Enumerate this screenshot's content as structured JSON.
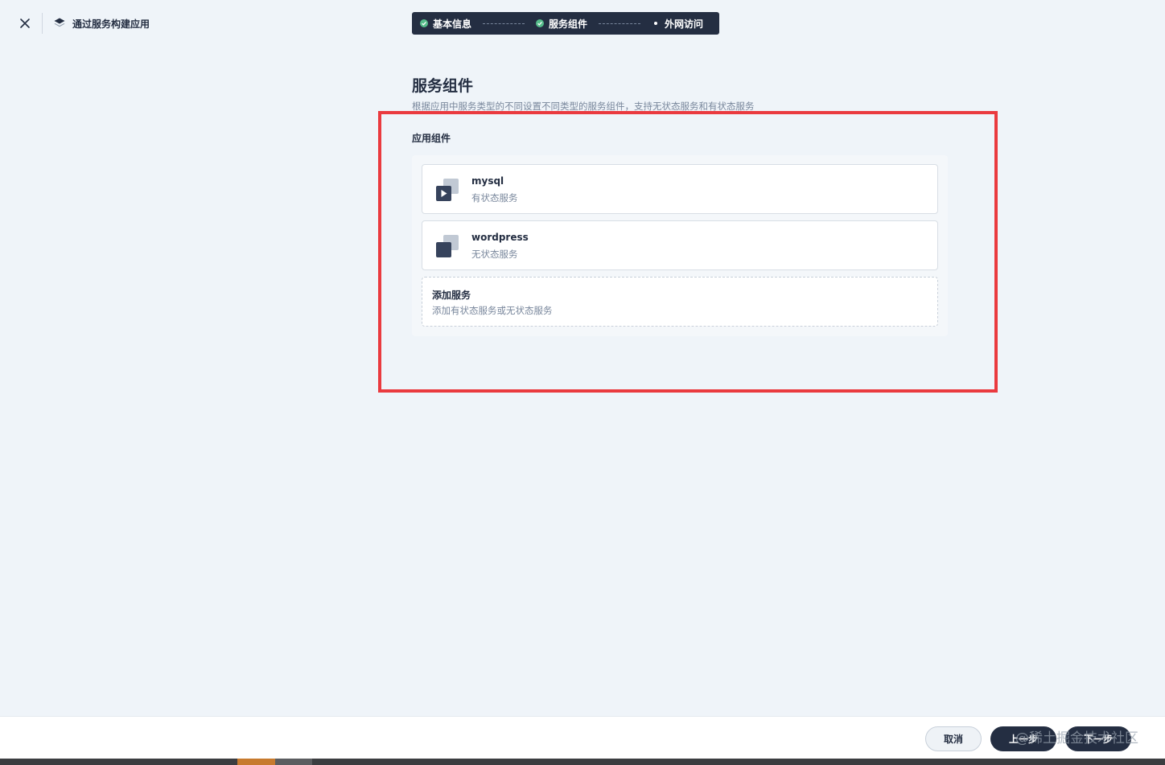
{
  "header": {
    "title": "通过服务构建应用"
  },
  "stepper": {
    "steps": [
      {
        "label": "基本信息",
        "status": "done"
      },
      {
        "label": "服务组件",
        "status": "done"
      },
      {
        "label": "外网访问",
        "status": "current"
      }
    ]
  },
  "main": {
    "title": "服务组件",
    "description": "根据应用中服务类型的不同设置不同类型的服务组件，支持无状态服务和有状态服务",
    "section_label": "应用组件",
    "services": [
      {
        "name": "mysql",
        "type": "有状态服务",
        "icon": "stateful-service-icon"
      },
      {
        "name": "wordpress",
        "type": "无状态服务",
        "icon": "stateless-service-icon"
      }
    ],
    "add_service": {
      "title": "添加服务",
      "description": "添加有状态服务或无状态服务"
    }
  },
  "footer": {
    "cancel_label": "取消",
    "prev_label": "上一步",
    "next_label": "下一步",
    "watermark": "@稀土掘金技术社区"
  },
  "colors": {
    "dark": "#242e42",
    "success": "#55bc8a",
    "highlight": "#ea3a3f",
    "background": "#eff4f9"
  }
}
